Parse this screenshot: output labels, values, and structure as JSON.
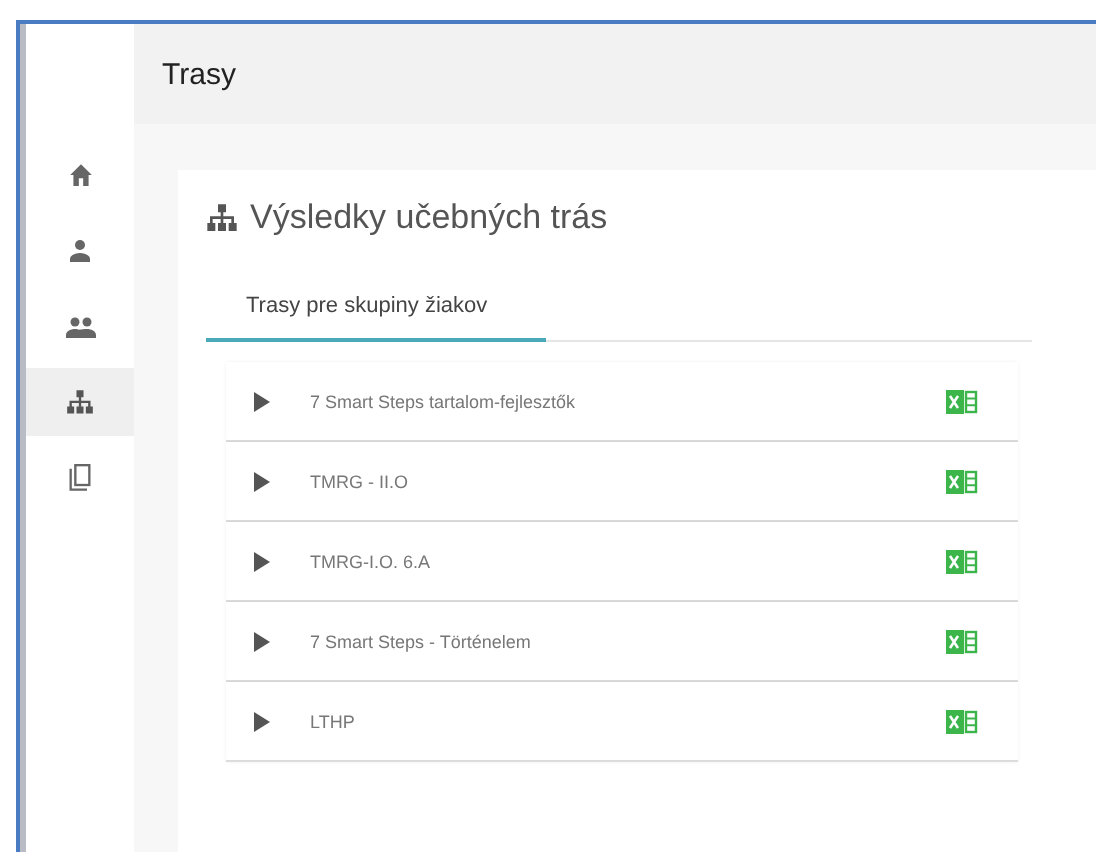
{
  "sidebar": {
    "items": [
      {
        "kind": "home",
        "selected": false
      },
      {
        "kind": "person",
        "selected": false
      },
      {
        "kind": "group",
        "selected": false
      },
      {
        "kind": "sitemap",
        "selected": true
      },
      {
        "kind": "copy",
        "selected": false
      }
    ]
  },
  "header": {
    "title": "Trasy"
  },
  "card": {
    "title": "Výsledky učebných trás",
    "tabs": [
      {
        "label": "Trasy pre skupiny žiakov",
        "selected": true
      }
    ],
    "rows": [
      {
        "name": "7 Smart Steps tartalom-fejlesztők",
        "expanded": false
      },
      {
        "name": "TMRG - II.O",
        "expanded": false
      },
      {
        "name": "TMRG-I.O. 6.A",
        "expanded": false
      },
      {
        "name": "7 Smart Steps - Történelem",
        "expanded": false
      },
      {
        "name": "LTHP",
        "expanded": false
      }
    ]
  }
}
